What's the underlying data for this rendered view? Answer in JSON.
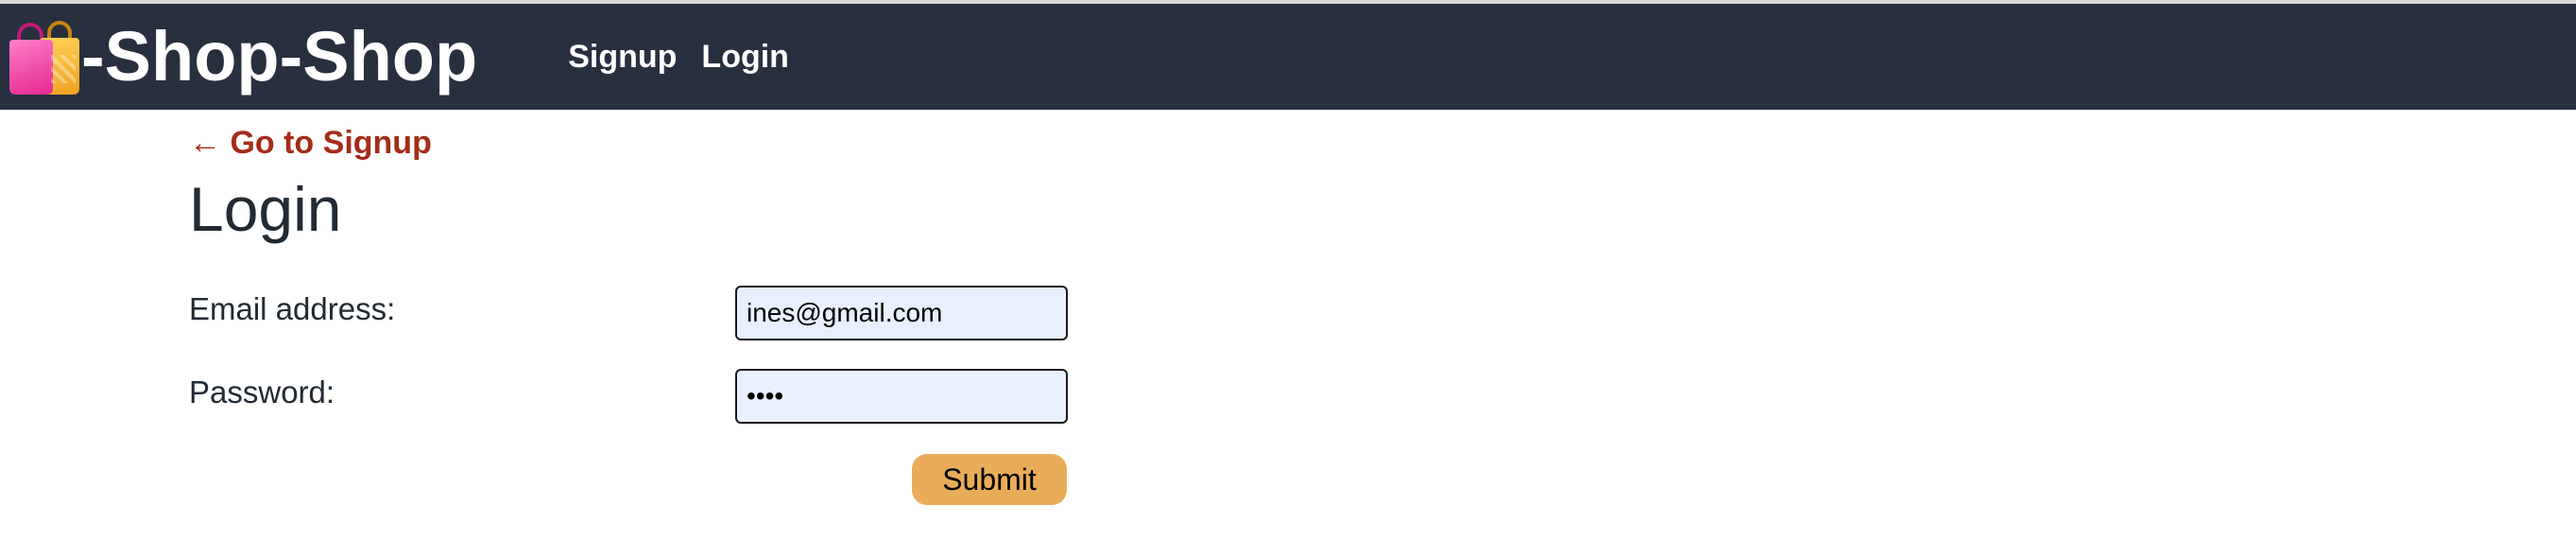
{
  "header": {
    "brand_icon": "shopping-bags-icon",
    "brand_text": "-Shop-Shop",
    "nav": [
      {
        "label": "Signup"
      },
      {
        "label": "Login"
      }
    ]
  },
  "main": {
    "back_link": "← Go to Signup",
    "title": "Login",
    "form": {
      "email_label": "Email address:",
      "email_value": "ines@gmail.com",
      "password_label": "Password:",
      "password_value": "••••",
      "submit_label": "Submit"
    }
  },
  "colors": {
    "header_bg": "#283040",
    "link": "#a52c17",
    "input_bg": "#e8f0fe",
    "submit_bg": "#e9ad5a"
  }
}
